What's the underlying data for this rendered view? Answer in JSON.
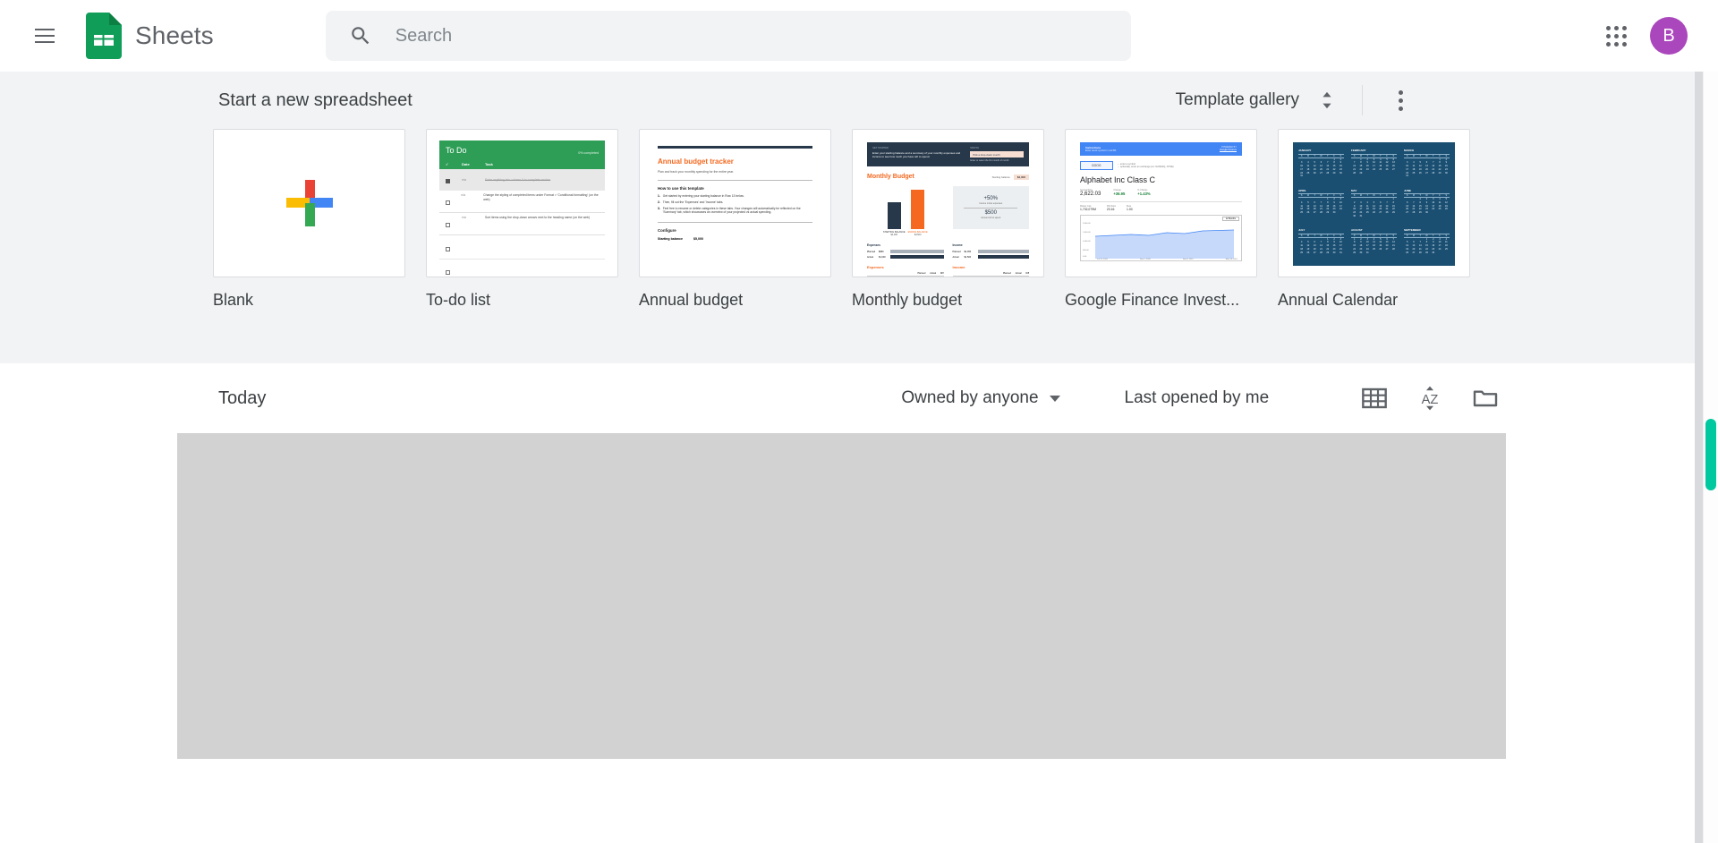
{
  "header": {
    "menu_icon": "hamburger-menu-icon",
    "logo_icon": "sheets-logo-icon",
    "brand_name": "Sheets",
    "search": {
      "icon": "search-icon",
      "placeholder": "Search",
      "value": ""
    },
    "apps_icon": "apps-grid-icon",
    "avatar": {
      "initial": "B",
      "color": "#ab47bc"
    }
  },
  "templates": {
    "section_title": "Start a new spreadsheet",
    "gallery_link": "Template gallery",
    "gallery_toggle_icon": "chevron-up-down-icon",
    "overflow_icon": "more-vert-icon",
    "cards": [
      {
        "label": "Blank",
        "thumb_type": "blank-plus",
        "colors": {
          "red": "#ea4335",
          "yellow": "#fbbc04",
          "blue": "#4285f4",
          "green": "#34a853"
        }
      },
      {
        "label": "To-do list",
        "thumb_type": "todo",
        "header_title": "To Do",
        "header_right": "0% completed",
        "columns": [
          "",
          "Date",
          "Task"
        ],
        "rows": [
          "Enter anything into column A to complete section",
          "Change the styling of completed items under Format > 'Conditional formatting' (on the web)",
          "Sort items using the drop-down arrows next to the heading name (on the web)"
        ],
        "accent": "#2e9e57"
      },
      {
        "label": "Annual budget",
        "thumb_type": "annual-budget",
        "title": "Annual budget tracker",
        "subtitle": "Plan and track your monthly spending for the entire year.",
        "section_heading": "How to use this template",
        "steps": [
          "Get started by entering your starting balance in Row 13 below.",
          "Then, fill out the 'Expenses' and 'Income' tabs.",
          "Feel free to rename or delete categories in these tabs. Your changes will automatically be reflected on the 'Summary' tab, which showcases an overview of your projected vs actual spending."
        ],
        "configure_heading": "Configure",
        "configure_row": {
          "label": "Starting balance",
          "value": "$5,000"
        },
        "accent": "#f4681f",
        "bar": "#27384a"
      },
      {
        "label": "Monthly budget",
        "thumb_type": "monthly-budget",
        "title": "Monthly Budget",
        "banner_heading": "GET STARTED",
        "banner_text": "Enter your starting balance and a summary of your monthly expenses and income to see how much you have left to spend.",
        "banner_right_heading": "MONTH",
        "banner_right_value": "Pick a drop-down month",
        "summary_label": "Starting balance",
        "summary_value": "$4,000",
        "stat_percent": "+50%",
        "stat_percent_caption": "Income minus expenses",
        "stat_amount": "$500",
        "stat_amount_caption": "Amount left to spend",
        "bars": [
          {
            "label": "STARTING BALANCE",
            "value": "$4,000",
            "color": "#27384a",
            "height_pct": 62
          },
          {
            "label": "ENDING BALANCE",
            "value": "$4,500",
            "color": "#f4681f",
            "height_pct": 92
          }
        ],
        "expenses_heading": "Expenses",
        "income_heading": "Income",
        "meters": [
          {
            "group": "Expenses",
            "label": "Planned",
            "value": "$950",
            "fill_pct": 72,
            "color": "#a7afb9"
          },
          {
            "group": "Expenses",
            "label": "Actual",
            "value": "$1,000",
            "fill_pct": 100,
            "color": "#27384a"
          },
          {
            "group": "Income",
            "label": "Planned",
            "value": "$1,450",
            "fill_pct": 80,
            "color": "#a7afb9"
          },
          {
            "group": "Income",
            "label": "Actual",
            "value": "$1,500",
            "fill_pct": 100,
            "color": "#27384a"
          }
        ],
        "table_headers": [
          "Planned",
          "Actual",
          "Diff"
        ],
        "accent": "#f4681f",
        "dark": "#27384a"
      },
      {
        "label": "Google Finance Invest...",
        "thumb_type": "finance",
        "banner_heading": "Instructions",
        "banner_sub": "Enter stock symbol in cell B4",
        "banner_right_heading": "POWERED BY",
        "banner_right_link": "Google Finance",
        "symbol_value": "GOOG",
        "hint_lines": [
          "← enter a symbol",
          "← optionally, enter an exchange (ex: NASDAQ, NYSE)"
        ],
        "company_name": "Alphabet Inc Class C",
        "stats": [
          {
            "label": "Current Price",
            "value": "2,622.03",
            "color": "#202124"
          },
          {
            "label": "Change",
            "value": "+36.95",
            "color": "#188038"
          },
          {
            "label": "% Change",
            "value": "+1.43%",
            "color": "#188038"
          }
        ],
        "stats2": [
          {
            "label": "Market Cap",
            "value": "1,732,079M"
          },
          {
            "label": "P/E Ratio",
            "value": "23.16"
          },
          {
            "label": "Beta",
            "value": "1.00"
          }
        ],
        "chart_legend": "12 Months",
        "y_ticks": [
          "2,000.00",
          "1,500.00",
          "1,000.00",
          "500.00",
          "0.00"
        ],
        "x_ticks": [
          "Jul 23, 2020",
          "Nov 2, 2020",
          "Feb 8, 2021",
          "May 18, 2021"
        ],
        "accent": "#4285f4"
      },
      {
        "label": "Annual Calendar",
        "thumb_type": "calendar",
        "background": "#1b4f72",
        "weekday_initials": [
          "S",
          "M",
          "T",
          "W",
          "T",
          "F",
          "S"
        ],
        "months": [
          {
            "name": "JANUARY",
            "start_offset": 5,
            "days": 31
          },
          {
            "name": "FEBRUARY",
            "start_offset": 1,
            "days": 29
          },
          {
            "name": "MARCH",
            "start_offset": 5,
            "days": 31
          },
          {
            "name": "APRIL",
            "start_offset": 4,
            "days": 30
          },
          {
            "name": "MAY",
            "start_offset": 6,
            "days": 31
          },
          {
            "name": "JUNE",
            "start_offset": 2,
            "days": 30
          },
          {
            "name": "JULY",
            "start_offset": 4,
            "days": 31
          },
          {
            "name": "AUGUST",
            "start_offset": 0,
            "days": 31
          },
          {
            "name": "SEPTEMBER",
            "start_offset": 3,
            "days": 30
          }
        ]
      }
    ]
  },
  "filelist": {
    "section_label": "Today",
    "owner_filter": "Owned by anyone",
    "sort_label": "Last opened by me",
    "icons": {
      "grid_view": "grid-view-icon",
      "sort_az": "sort-az-icon",
      "folder": "folder-icon"
    }
  },
  "scrollbar": {
    "thumb_color": "#00c9a0"
  }
}
